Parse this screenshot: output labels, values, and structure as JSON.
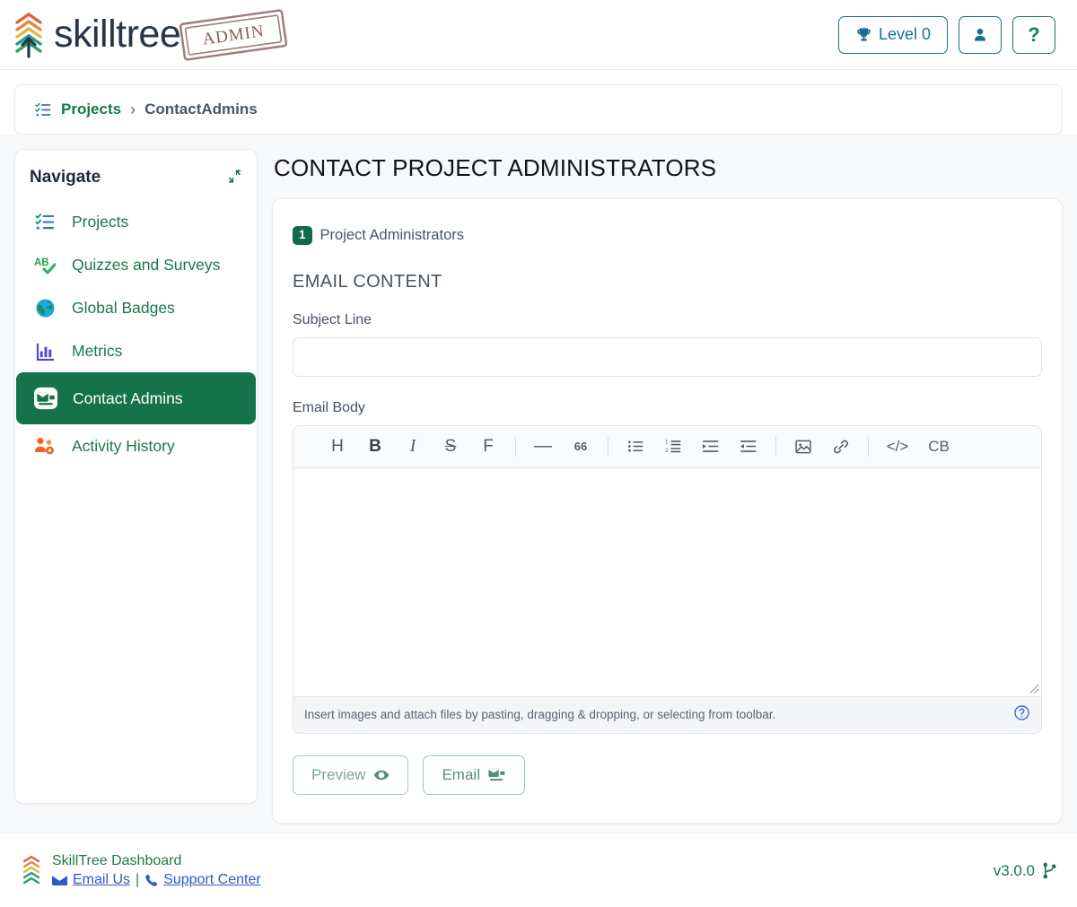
{
  "header": {
    "logo_text": "skilltree",
    "stamp_text": "ADMIN",
    "level_button": {
      "label": "Level 0",
      "icon": "trophy-icon"
    },
    "user_button": {
      "label": "",
      "icon": "user-icon"
    },
    "help_button": {
      "label": "?",
      "icon": "question-mark-icon"
    }
  },
  "breadcrumb": {
    "icon": "list-check-icon",
    "root": "Projects",
    "separator": "›",
    "current": "ContactAdmins"
  },
  "sidebar": {
    "title": "Navigate",
    "collapse_icon": "compress-arrows-icon",
    "items": [
      {
        "label": "Projects",
        "icon": "list-check-icon",
        "active": false
      },
      {
        "label": "Quizzes and Surveys",
        "icon": "ab-check-icon",
        "active": false
      },
      {
        "label": "Global Badges",
        "icon": "globe-icon",
        "active": false
      },
      {
        "label": "Metrics",
        "icon": "bar-chart-icon",
        "active": false
      },
      {
        "label": "Contact Admins",
        "icon": "mail-bulk-icon",
        "active": true
      },
      {
        "label": "Activity History",
        "icon": "users-cog-icon",
        "active": false
      }
    ]
  },
  "main": {
    "page_title": "CONTACT PROJECT ADMINISTRATORS",
    "admins": {
      "count": "1",
      "label": "Project Administrators"
    },
    "section_title": "EMAIL CONTENT",
    "subject": {
      "label": "Subject Line",
      "value": "",
      "placeholder": ""
    },
    "body": {
      "label": "Email Body",
      "value": "",
      "placeholder": ""
    },
    "toolbar": [
      {
        "name": "heading-icon",
        "glyph": "H",
        "type": "text"
      },
      {
        "name": "bold-icon",
        "glyph": "B",
        "type": "bold"
      },
      {
        "name": "italic-icon",
        "glyph": "I",
        "type": "italic"
      },
      {
        "name": "strikethrough-icon",
        "glyph": "S",
        "type": "strike"
      },
      {
        "name": "font-icon",
        "glyph": "F",
        "type": "text"
      },
      {
        "name": "toolbar-divider-1",
        "glyph": "",
        "type": "sep"
      },
      {
        "name": "horizontal-rule-icon",
        "glyph": "—",
        "type": "text"
      },
      {
        "name": "blockquote-icon",
        "glyph": "66",
        "type": "quote"
      },
      {
        "name": "toolbar-divider-2",
        "glyph": "",
        "type": "sep"
      },
      {
        "name": "bullet-list-icon",
        "glyph": "",
        "type": "svg-ul"
      },
      {
        "name": "numbered-list-icon",
        "glyph": "",
        "type": "svg-ol"
      },
      {
        "name": "indent-icon",
        "glyph": "",
        "type": "svg-indent"
      },
      {
        "name": "outdent-icon",
        "glyph": "",
        "type": "svg-outdent"
      },
      {
        "name": "toolbar-divider-3",
        "glyph": "",
        "type": "sep"
      },
      {
        "name": "image-icon",
        "glyph": "",
        "type": "svg-image"
      },
      {
        "name": "link-icon",
        "glyph": "",
        "type": "svg-link"
      },
      {
        "name": "toolbar-divider-4",
        "glyph": "",
        "type": "sep"
      },
      {
        "name": "code-icon",
        "glyph": "</>",
        "type": "text"
      },
      {
        "name": "code-block-icon",
        "glyph": "CB",
        "type": "text"
      }
    ],
    "editor_hint": "Insert images and attach files by pasting, dragging & dropping, or selecting from toolbar.",
    "editor_help_icon": "question-circle-icon",
    "preview_button": {
      "label": "Preview",
      "icon": "eye-icon"
    },
    "email_button": {
      "label": "Email",
      "icon": "mail-bulk-icon"
    }
  },
  "footer": {
    "title": "SkillTree Dashboard",
    "email_link": "Email Us",
    "separator": "|",
    "support_link": "Support Center",
    "version": "v3.0.0",
    "version_icon": "code-branch-icon",
    "email_icon": "envelope-icon",
    "phone_icon": "phone-icon"
  },
  "colors": {
    "brand_green": "#15734c",
    "link_blue": "#2b5cc6",
    "accent_blue": "#1a6e9e",
    "page_bg": "#f7f8fa"
  }
}
